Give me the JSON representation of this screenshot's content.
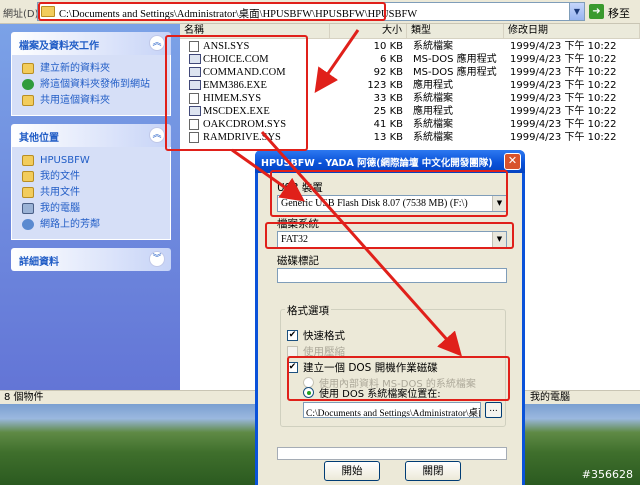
{
  "address_bar": {
    "label": "網址(D)",
    "path": "C:\\Documents and Settings\\Administrator\\桌面\\HPUSBFW\\HPUSBFW\\HPUSBFW",
    "go_label": "移至"
  },
  "sidebar": {
    "tasks": {
      "title": "檔案及資料夾工作",
      "items": [
        {
          "label": "建立新的資料夾"
        },
        {
          "label": "將這個資料夾發佈到網站"
        },
        {
          "label": "共用這個資料夾"
        }
      ]
    },
    "places": {
      "title": "其他位置",
      "items": [
        {
          "label": "HPUSBFW"
        },
        {
          "label": "我的文件"
        },
        {
          "label": "共用文件"
        },
        {
          "label": "我的電腦"
        },
        {
          "label": "網路上的芳鄰"
        }
      ]
    },
    "details": {
      "title": "詳細資料"
    }
  },
  "file_list": {
    "columns": {
      "name": "名稱",
      "size": "大小",
      "type": "類型",
      "modified": "修改日期"
    },
    "files": [
      {
        "name": "ANSI.SYS",
        "size": "10 KB",
        "type": "系統檔案",
        "modified": "1999/4/23 下午 10:22"
      },
      {
        "name": "CHOICE.COM",
        "size": "6 KB",
        "type": "MS-DOS 應用程式",
        "modified": "1999/4/23 下午 10:22"
      },
      {
        "name": "COMMAND.COM",
        "size": "92 KB",
        "type": "MS-DOS 應用程式",
        "modified": "1999/4/23 下午 10:22"
      },
      {
        "name": "EMM386.EXE",
        "size": "123 KB",
        "type": "應用程式",
        "modified": "1999/4/23 下午 10:22"
      },
      {
        "name": "HIMEM.SYS",
        "size": "33 KB",
        "type": "系統檔案",
        "modified": "1999/4/23 下午 10:22"
      },
      {
        "name": "MSCDEX.EXE",
        "size": "25 KB",
        "type": "應用程式",
        "modified": "1999/4/23 下午 10:22"
      },
      {
        "name": "OAKCDROM.SYS",
        "size": "41 KB",
        "type": "系統檔案",
        "modified": "1999/4/23 下午 10:22"
      },
      {
        "name": "RAMDRIVE.SYS",
        "size": "13 KB",
        "type": "系統檔案",
        "modified": "1999/4/23 下午 10:22"
      }
    ]
  },
  "status_bar": {
    "left": "8 個物件",
    "right": "我的電腦"
  },
  "dialog": {
    "title": "HPUSBFW - YADA 阿德(網際論壇 中文化開發團隊)",
    "device_label": "USB 裝置",
    "device_value": "Generic USB Flash Disk 8.07 (7538 MB) (F:\\)",
    "fs_label": "檔案系統",
    "fs_value": "FAT32",
    "volume_label": "磁碟標記",
    "volume_value": "",
    "options_title": "格式選項",
    "quick_format": {
      "label": "快速格式",
      "checked": true
    },
    "compress": {
      "label": "使用壓縮",
      "checked": false
    },
    "create_dos": {
      "label": "建立一個 DOS 開機作業磁碟",
      "checked": true
    },
    "internal_dos": {
      "label": "使用內部資料 MS-DOS 的系統檔案"
    },
    "use_dos_path": {
      "label": "使用 DOS 系統檔案位置在:",
      "selected": true
    },
    "dos_path": "C:\\Documents and Settings\\Administrator\\桌面",
    "browse_label": "...",
    "start_label": "開始",
    "close_label": "關閉",
    "progress": 0
  },
  "watermark": "#356628",
  "annotation_color": "#e0201a"
}
